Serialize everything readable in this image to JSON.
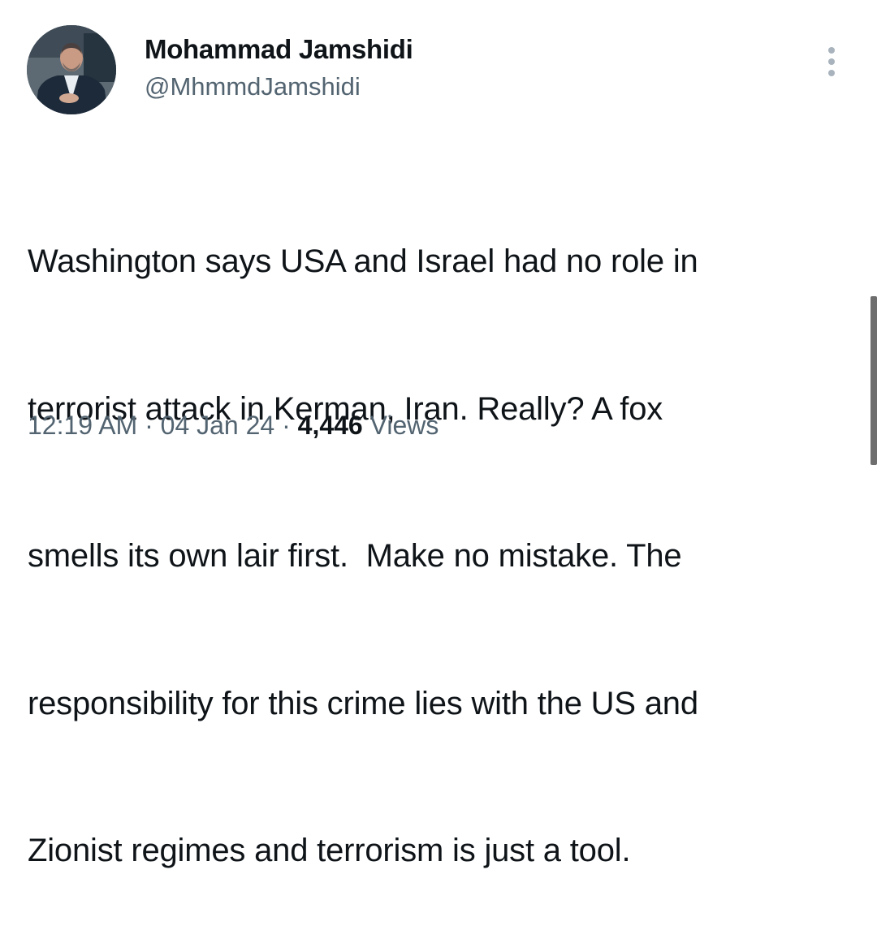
{
  "author": {
    "display_name": "Mohammad Jamshidi",
    "handle": "@MhmmdJamshidi"
  },
  "icons": {
    "more": "more-vertical-icon",
    "avatar": "profile-photo"
  },
  "tweet": {
    "lines": [
      "Washington says USA and Israel had no role in",
      "terrorist attack in Kerman, Iran. Really? A fox",
      "smells its own lair first.  Make no mistake. The",
      "responsibility for this crime lies with the US and",
      "Zionist regimes and terrorism is just a tool."
    ]
  },
  "meta": {
    "time": "12:19 AM",
    "separator": " · ",
    "date": "04 Jan 24",
    "views_count": "4,446",
    "views_label": " Views"
  },
  "colors": {
    "text_primary": "#0f1419",
    "text_secondary": "#536471"
  }
}
